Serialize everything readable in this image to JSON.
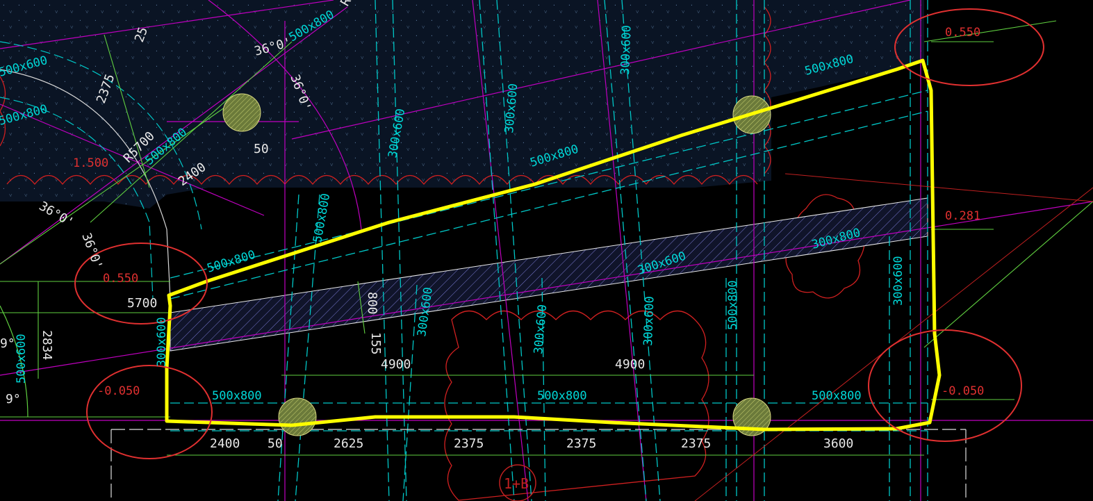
{
  "colors": {
    "background": "#000000",
    "beam_cyan": "#00d8d8",
    "axis_magenta": "#c000c0",
    "dimension_green": "#60d040",
    "highlight_yellow": "#ffff00",
    "elevation_red": "#e03030",
    "text_white": "#e8e8e8",
    "hatch": "#8080ff"
  },
  "elevations": {
    "top_right": "0.550",
    "mid_right": "0.281",
    "bottom_right": "-0.050",
    "left_mid": "0.550",
    "left_bottom": "-0.050",
    "left_top": "1.500"
  },
  "beam_labels": {
    "b1": "500x800",
    "b2": "500x800",
    "b3": "500x800",
    "b4": "500x800",
    "b5": "500x800",
    "b6": "500x800",
    "b7": "500x800",
    "b8": "500x800",
    "b9": "500x800",
    "b10": "500x800",
    "b11": "300x600",
    "b12": "300x600",
    "b13": "300x600",
    "b14": "300x600",
    "b15": "300x600",
    "b16": "300x600",
    "b17": "300x600",
    "b18": "300x600",
    "b19": "300x800",
    "b20": "500x600",
    "b21": "500x600",
    "b22": "500x800",
    "b23": "300x600"
  },
  "dimensions": {
    "bottom_2400": "2400",
    "bottom_50": "50",
    "bottom_2625": "2625",
    "bottom_2375a": "2375",
    "bottom_2375b": "2375",
    "bottom_2375c": "2375",
    "bottom_3600": "3600",
    "span_4900a": "4900",
    "span_4900b": "4900",
    "left_5700": "5700",
    "left_2834": "2834",
    "slab_800": "800",
    "slab_155": "155",
    "arc_2375": "2375",
    "arc_2400": "2400",
    "arc_50": "50",
    "arc_25": "25",
    "radius": "R5700"
  },
  "angles": {
    "a1": "36°0'",
    "a2": "36°0'",
    "a3": "36°0'",
    "a4": "36°0'",
    "a5": "9°",
    "a6": "9°"
  },
  "axis_bubble": "1+B",
  "top_fragment": "Ro"
}
